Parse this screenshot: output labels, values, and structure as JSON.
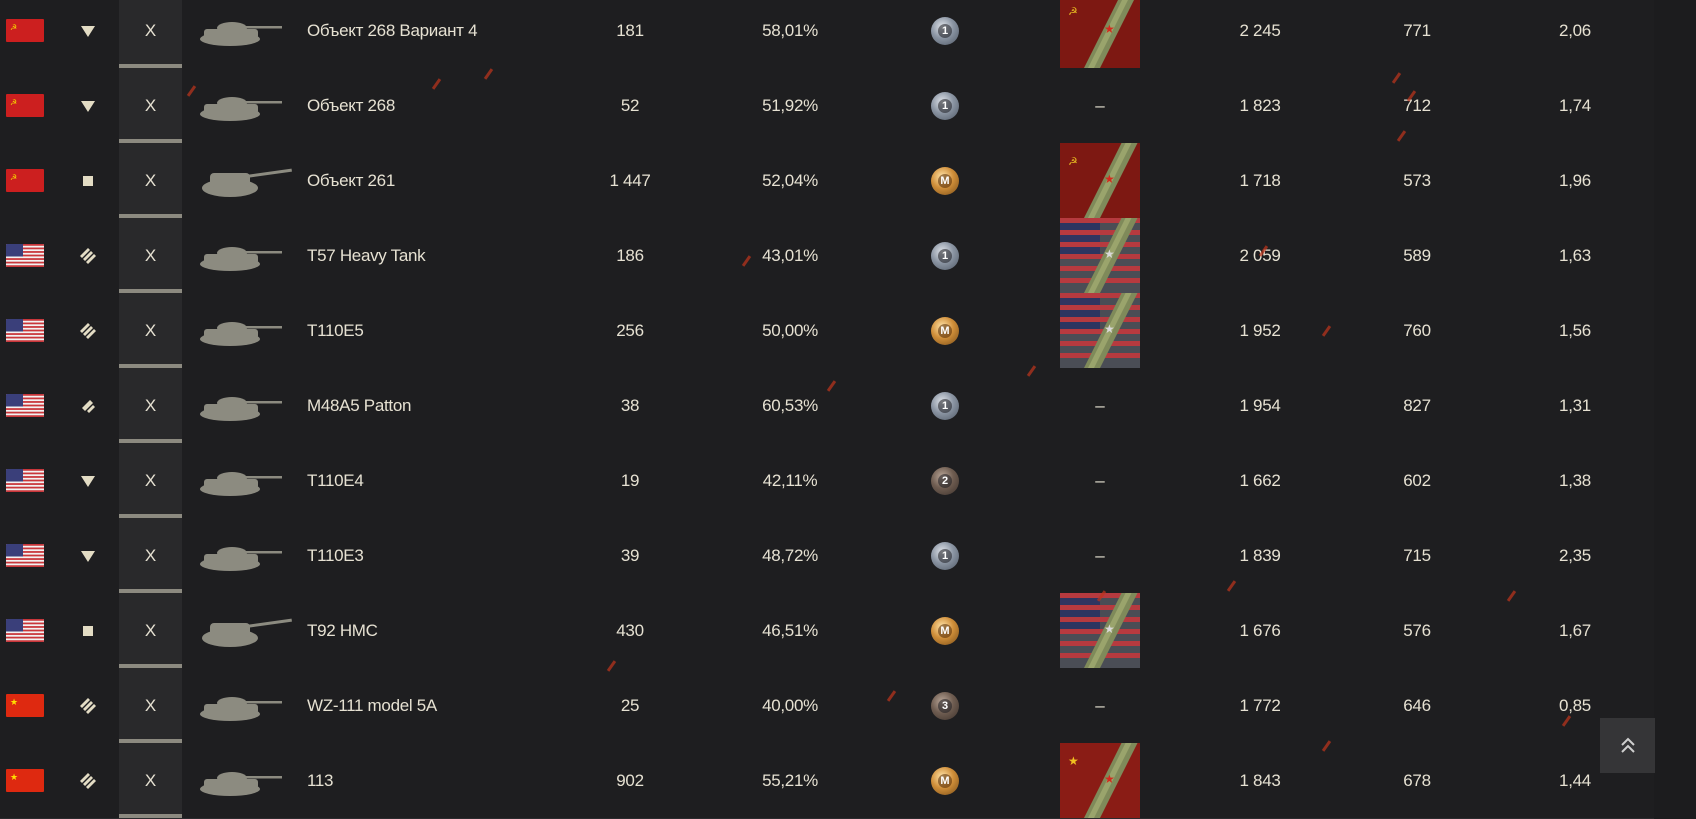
{
  "rows": [
    {
      "flag": "ussr",
      "type": "heavy",
      "tier": "X",
      "name": "Объект 268 Вариант 4",
      "battles": "181",
      "winrate": "58,01%",
      "mastery": "1",
      "mastery_style": "silver",
      "marks": "ussr",
      "damage": "2 245",
      "exp": "771",
      "ratio": "2,06"
    },
    {
      "flag": "ussr",
      "type": "heavy",
      "tier": "X",
      "name": "Объект 268",
      "battles": "52",
      "winrate": "51,92%",
      "mastery": "1",
      "mastery_style": "silver",
      "marks": "–",
      "damage": "1 823",
      "exp": "712",
      "ratio": "1,74"
    },
    {
      "flag": "ussr",
      "type": "spg",
      "tier": "X",
      "name": "Объект 261",
      "battles": "1 447",
      "winrate": "52,04%",
      "mastery": "M",
      "mastery_style": "gold",
      "marks": "ussr",
      "damage": "1 718",
      "exp": "573",
      "ratio": "1,96"
    },
    {
      "flag": "usa",
      "type": "medium",
      "tier": "X",
      "name": "T57 Heavy Tank",
      "battles": "186",
      "winrate": "43,01%",
      "mastery": "1",
      "mastery_style": "silver",
      "marks": "usa",
      "damage": "2 059",
      "exp": "589",
      "ratio": "1,63"
    },
    {
      "flag": "usa",
      "type": "medium",
      "tier": "X",
      "name": "T110E5",
      "battles": "256",
      "winrate": "50,00%",
      "mastery": "M",
      "mastery_style": "gold",
      "marks": "usa",
      "damage": "1 952",
      "exp": "760",
      "ratio": "1,56"
    },
    {
      "flag": "usa",
      "type": "light",
      "tier": "X",
      "name": "M48A5 Patton",
      "battles": "38",
      "winrate": "60,53%",
      "mastery": "1",
      "mastery_style": "silver",
      "marks": "–",
      "damage": "1 954",
      "exp": "827",
      "ratio": "1,31"
    },
    {
      "flag": "usa",
      "type": "heavy",
      "tier": "X",
      "name": "T110E4",
      "battles": "19",
      "winrate": "42,11%",
      "mastery": "2",
      "mastery_style": "bronze",
      "marks": "–",
      "damage": "1 662",
      "exp": "602",
      "ratio": "1,38"
    },
    {
      "flag": "usa",
      "type": "heavy",
      "tier": "X",
      "name": "T110E3",
      "battles": "39",
      "winrate": "48,72%",
      "mastery": "1",
      "mastery_style": "silver",
      "marks": "–",
      "damage": "1 839",
      "exp": "715",
      "ratio": "2,35"
    },
    {
      "flag": "usa",
      "type": "spg",
      "tier": "X",
      "name": "T92 HMC",
      "battles": "430",
      "winrate": "46,51%",
      "mastery": "M",
      "mastery_style": "gold",
      "marks": "usa",
      "damage": "1 676",
      "exp": "576",
      "ratio": "1,67"
    },
    {
      "flag": "china",
      "type": "medium",
      "tier": "X",
      "name": "WZ-111 model 5A",
      "battles": "25",
      "winrate": "40,00%",
      "mastery": "3",
      "mastery_style": "bronze",
      "marks": "–",
      "damage": "1 772",
      "exp": "646",
      "ratio": "0,85"
    },
    {
      "flag": "china",
      "type": "medium",
      "tier": "X",
      "name": "113",
      "battles": "902",
      "winrate": "55,21%",
      "mastery": "M",
      "mastery_style": "gold",
      "marks": "china",
      "damage": "1 843",
      "exp": "678",
      "ratio": "1,44"
    }
  ],
  "icons": {
    "expand": "chevron-down-icon",
    "scroll_top": "double-chevron-up-icon"
  },
  "colors": {
    "ussr_flag": "#cc1f1f",
    "china_flag": "#de2910",
    "accent_triangle": "#e3dcc4"
  }
}
